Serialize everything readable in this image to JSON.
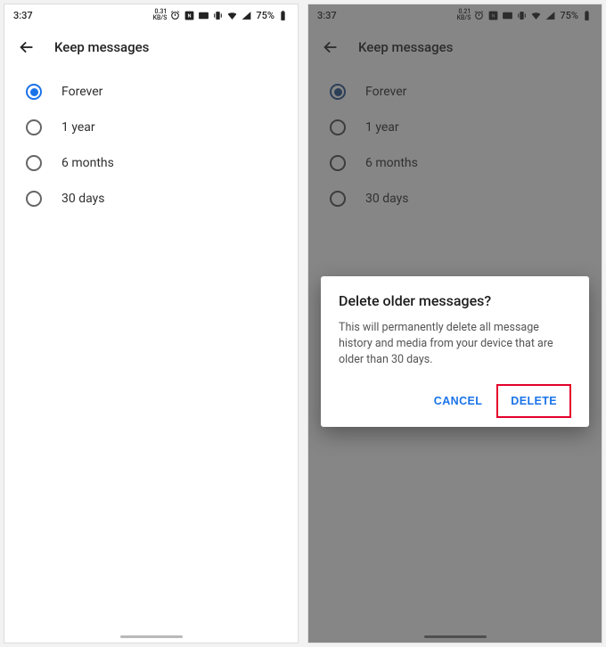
{
  "status": {
    "time": "3:37",
    "kbps_left": "0.31",
    "kbps_unit_left": "KB/S",
    "kbps_right": "0.21",
    "kbps_unit_right": "KB/S",
    "battery_pct": "75%"
  },
  "appbar": {
    "title": "Keep messages"
  },
  "options": [
    {
      "label": "Forever",
      "selected": true
    },
    {
      "label": "1 year",
      "selected": false
    },
    {
      "label": "6 months",
      "selected": false
    },
    {
      "label": "30 days",
      "selected": false
    }
  ],
  "dialog": {
    "title": "Delete older messages?",
    "body": "This will permanently delete all message history and media from your device that are older than 30 days.",
    "cancel": "CANCEL",
    "confirm": "DELETE"
  }
}
